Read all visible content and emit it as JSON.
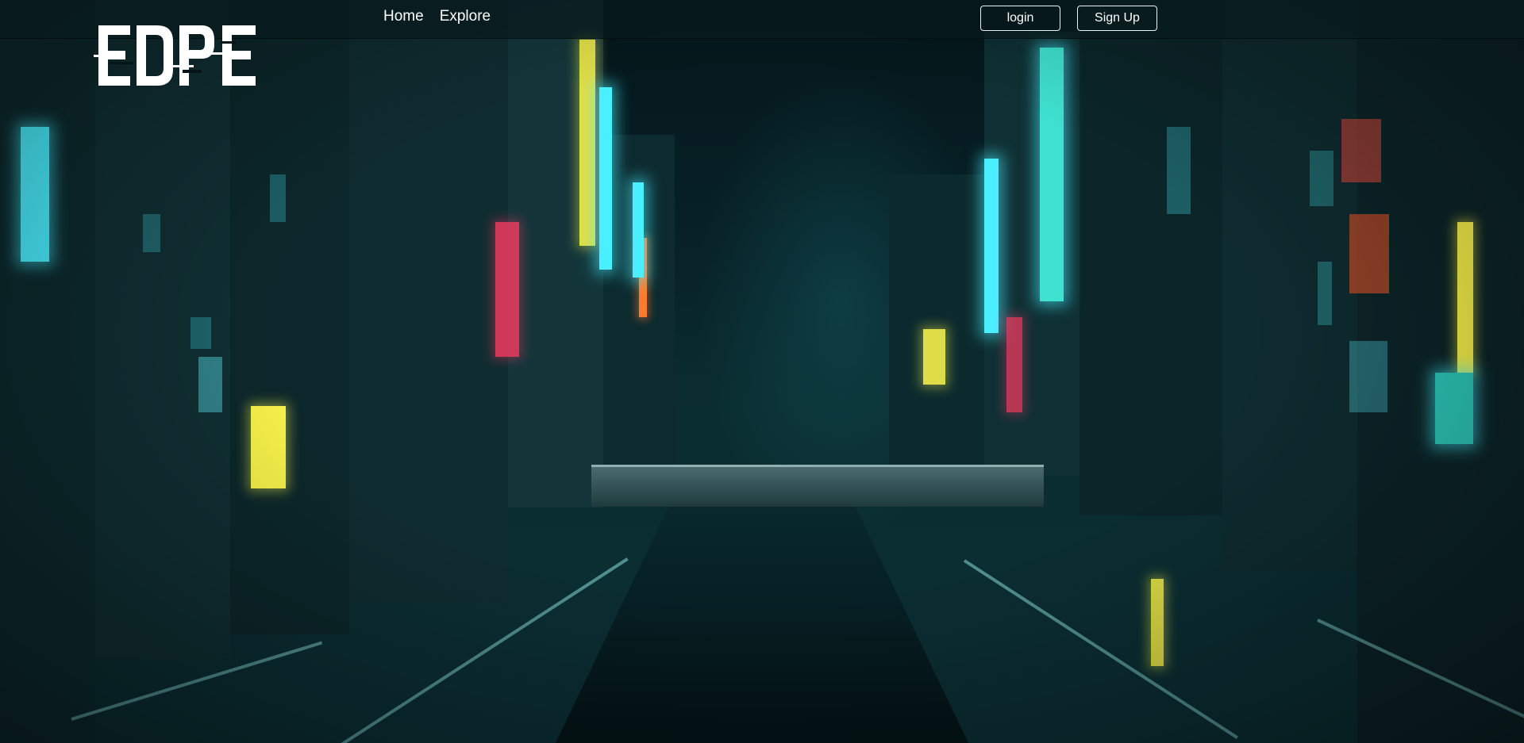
{
  "header": {
    "logo_text": "EDPE",
    "nav": [
      {
        "label": "Home"
      },
      {
        "label": "Explore"
      }
    ],
    "login_label": "login",
    "signup_label": "Sign Up"
  },
  "colors": {
    "accent_cyan": "#4af0ff",
    "text": "#ffffff",
    "background": "#061417"
  }
}
